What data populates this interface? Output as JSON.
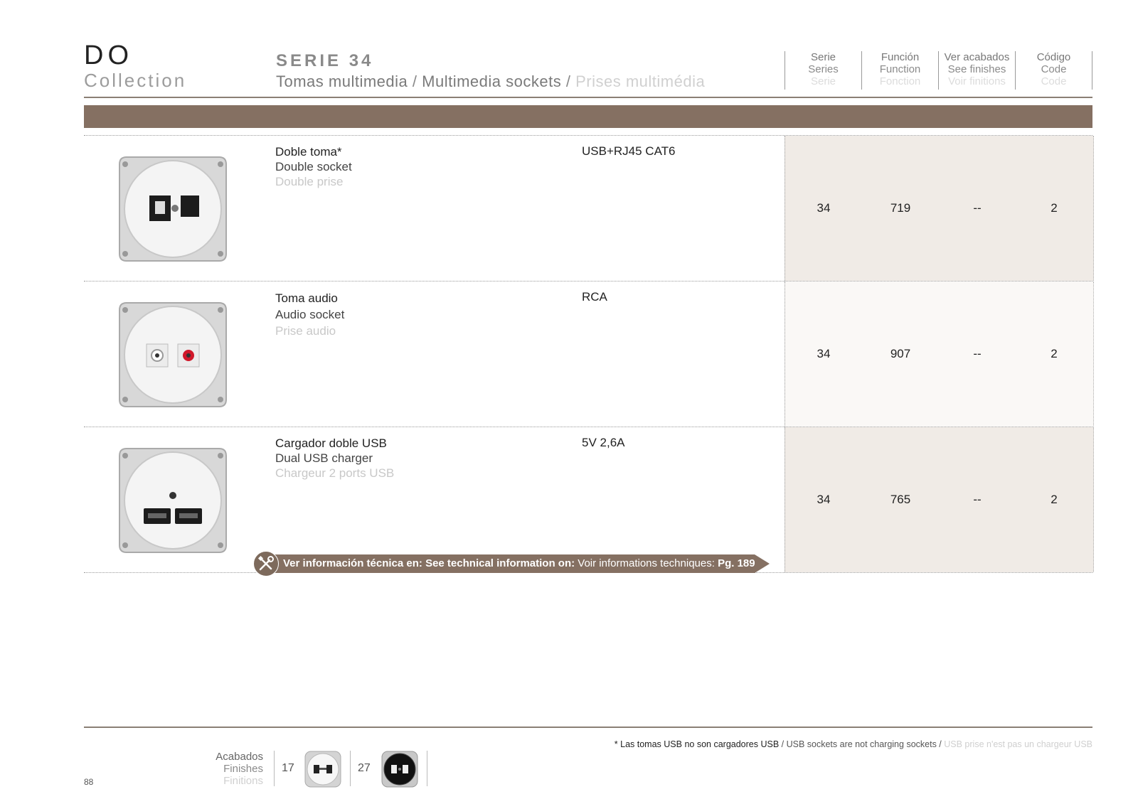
{
  "brand": {
    "do": "DO",
    "collection": "Collection"
  },
  "serie": {
    "title": "SERIE 34",
    "sub_es": "Tomas multimedia",
    "sub_en": "Multimedia sockets",
    "sub_fr": "Prises multimédia",
    "slash": "/"
  },
  "columns": [
    {
      "es": "Serie",
      "en": "Series",
      "fr": "Serie"
    },
    {
      "es": "Función",
      "en": "Function",
      "fr": "Fonction"
    },
    {
      "es": "Ver acabados",
      "en": "See finishes",
      "fr": "Voir finitions"
    },
    {
      "es": "Código",
      "en": "Code",
      "fr": "Code"
    }
  ],
  "rows": [
    {
      "es": "Doble toma*",
      "en": "Double socket",
      "fr": "Double prise",
      "spec": "USB+RJ45 CAT6",
      "serie": "34",
      "funcion": "719",
      "acabados": "--",
      "codigo": "2"
    },
    {
      "es": "Toma audio",
      "en": "Audio socket",
      "fr": "Prise audio",
      "spec": "RCA",
      "serie": "34",
      "funcion": "907",
      "acabados": "--",
      "codigo": "2"
    },
    {
      "es": "Cargador doble USB",
      "en": "Dual USB charger",
      "fr": "Chargeur 2 ports USB",
      "spec": "5V 2,6A",
      "serie": "34",
      "funcion": "765",
      "acabados": "--",
      "codigo": "2"
    }
  ],
  "tech": {
    "es": "Ver información técnica en:",
    "en": "See technical information on:",
    "fr": "Voir informations techniques:",
    "page": "Pg. 189"
  },
  "footnote": {
    "es": "* Las tomas USB no son cargadores USB",
    "en": "/ USB sockets are not charging sockets /",
    "fr": "USB prise n'est pas un chargeur USB"
  },
  "finishes": {
    "es": "Acabados",
    "en": "Finishes",
    "fr": "Finitions",
    "items": [
      {
        "num": "17",
        "color": "white"
      },
      {
        "num": "27",
        "color": "black"
      }
    ]
  },
  "page_number": "88",
  "colors": {
    "band": "#857062",
    "rule": "#8a7f75",
    "shade": "#f0ebe6"
  }
}
